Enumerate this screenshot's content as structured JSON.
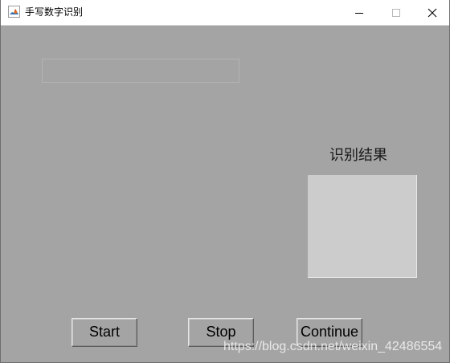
{
  "window": {
    "title": "手写数字识别",
    "icon": "matlab-icon",
    "controls": {
      "minimize_icon": "minimize-icon",
      "maximize_icon": "maximize-icon",
      "close_icon": "close-icon"
    }
  },
  "result": {
    "label": "识别结果",
    "value": ""
  },
  "buttons": {
    "start_label": "Start",
    "stop_label": "Stop",
    "continue_label": "Continue"
  },
  "watermark": "https://blog.csdn.net/weixin_42486554",
  "colors": {
    "panel_background": "#a4a4a4",
    "result_box": "#cccccc",
    "titlebar": "#ffffff"
  }
}
